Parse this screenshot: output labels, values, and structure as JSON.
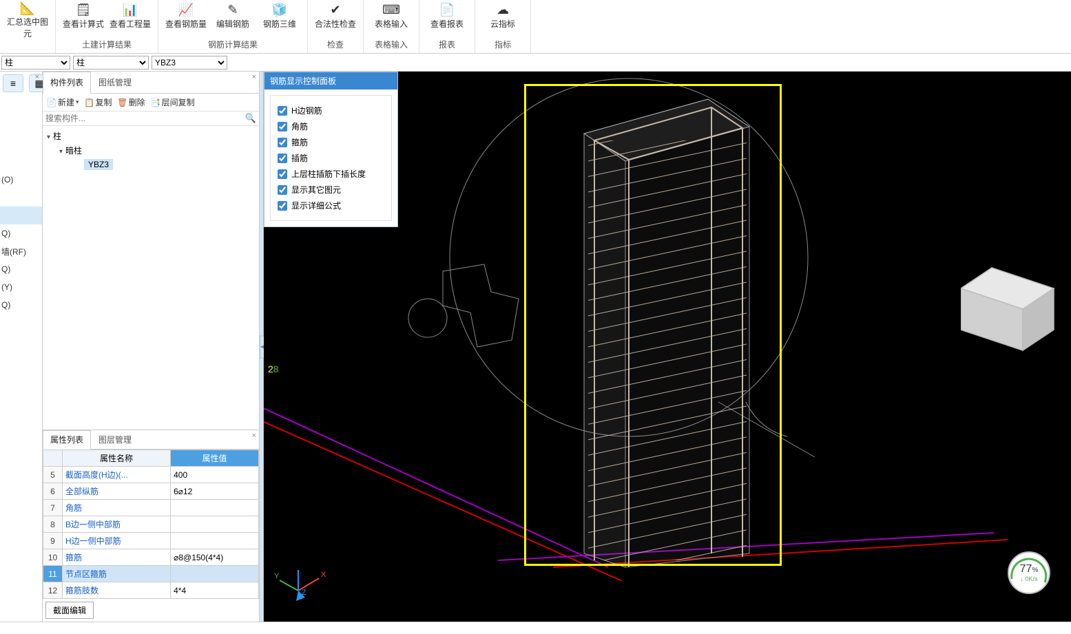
{
  "ribbon": {
    "groups": [
      {
        "label": "",
        "buttons": [
          {
            "name": "汇总选中图元",
            "icon": "📐",
            "dn": "summarize-selected-button"
          }
        ]
      },
      {
        "label": "土建计算结果",
        "buttons": [
          {
            "name": "查看计算式",
            "icon": "🗒",
            "dn": "view-formula-button"
          },
          {
            "name": "查看工程量",
            "icon": "📊",
            "dn": "view-quantity-button"
          }
        ]
      },
      {
        "label": "钢筋计算结果",
        "buttons": [
          {
            "name": "查看钢筋量",
            "icon": "📈",
            "dn": "view-rebar-qty-button"
          },
          {
            "name": "编辑钢筋",
            "icon": "✎",
            "dn": "edit-rebar-button"
          },
          {
            "name": "钢筋三维",
            "icon": "🧊",
            "dn": "rebar-3d-button"
          }
        ]
      },
      {
        "label": "检查",
        "buttons": [
          {
            "name": "合法性检查",
            "icon": "✔",
            "dn": "validity-check-button"
          }
        ]
      },
      {
        "label": "表格输入",
        "buttons": [
          {
            "name": "表格输入",
            "icon": "⌨",
            "dn": "table-input-button"
          }
        ]
      },
      {
        "label": "报表",
        "buttons": [
          {
            "name": "查看报表",
            "icon": "📄",
            "dn": "view-report-button"
          }
        ]
      },
      {
        "label": "指标",
        "buttons": [
          {
            "name": "云指标",
            "icon": "☁",
            "dn": "cloud-index-button"
          }
        ]
      }
    ]
  },
  "catbar": {
    "a": "柱",
    "b": "柱",
    "c": "YBZ3"
  },
  "treePanel": {
    "tabs": [
      "构件列表",
      "图纸管理"
    ],
    "toolbar": {
      "new": "新建",
      "copy": "复制",
      "del": "删除",
      "layercopy": "层间复制"
    },
    "searchPlaceholder": "搜索构件...",
    "root": "柱",
    "child": "暗柱",
    "leaf": "YBZ3"
  },
  "navItems": [
    "(O)",
    "",
    "",
    "Q)",
    "墙(RF)",
    "Q)",
    "(Y)",
    "Q)"
  ],
  "navItemSelIndex": 2,
  "props": {
    "tabs": [
      "属性列表",
      "图层管理"
    ],
    "header": {
      "name": "属性名称",
      "value": "属性值"
    },
    "rows": [
      {
        "idx": 5,
        "name": "截面高度(H边)(...",
        "val": "400",
        "link": true
      },
      {
        "idx": 6,
        "name": "全部纵筋",
        "val": "6⌀12",
        "link": true
      },
      {
        "idx": 7,
        "name": "角筋",
        "val": "",
        "link": true
      },
      {
        "idx": 8,
        "name": "B边一侧中部筋",
        "val": "",
        "link": true
      },
      {
        "idx": 9,
        "name": "H边一侧中部筋",
        "val": "",
        "link": true
      },
      {
        "idx": 10,
        "name": "箍筋",
        "val": "⌀8@150(4*4)",
        "link": true
      },
      {
        "idx": 11,
        "name": "节点区箍筋",
        "val": "",
        "link": true,
        "sel": true
      },
      {
        "idx": 12,
        "name": "箍筋肢数",
        "val": "4*4",
        "link": true
      }
    ],
    "editSection": "截面编辑"
  },
  "ctrlPanel": {
    "title": "钢筋显示控制面板",
    "items": [
      "H边钢筋",
      "角筋",
      "箍筋",
      "插筋",
      "上层柱插筋下插长度",
      "显示其它图元",
      "显示详细公式"
    ]
  },
  "viewport": {
    "marker": "28",
    "gauge": {
      "value": "77",
      "pct": "%",
      "speed": "0K/s"
    }
  }
}
